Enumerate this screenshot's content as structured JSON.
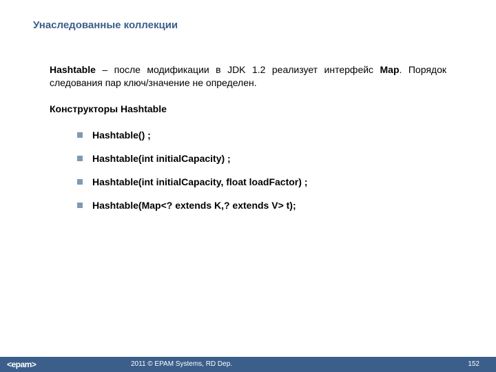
{
  "title": "Унаследованные коллекции",
  "para": {
    "b1": "Hashtable",
    "t1": " – после модификации в JDK 1.2 реализует интерфейс ",
    "b2": "Map",
    "t2": ". Порядок следования пар ключ/значение не определен."
  },
  "subhead": "Конструкторы Hashtable",
  "items": [
    "Hashtable() ;",
    "Hashtable(int initialCapacity) ;",
    "Hashtable(int initialCapacity, float loadFactor) ;",
    "Hashtable(Map<? extends K,? extends V> t);"
  ],
  "footer": {
    "logo": "<epam>",
    "copyright": "2011 © EPAM Systems, RD Dep.",
    "page": "152"
  }
}
